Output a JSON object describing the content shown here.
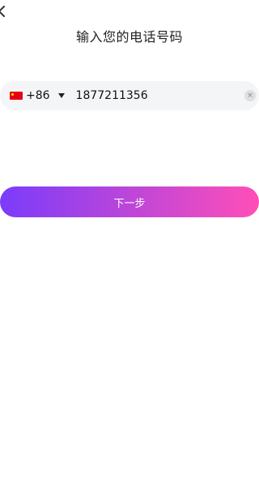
{
  "header": {
    "back_icon": "chevron-left-icon",
    "title": "输入您的电话号码"
  },
  "phone": {
    "flag_icon": "china-flag-icon",
    "country_code": "+86",
    "dropdown_icon": "caret-down-icon",
    "value": "1877211356",
    "clear_icon": "clear-x-icon",
    "clear_glyph": "×"
  },
  "actions": {
    "next_label": "下一步",
    "gradient_start": "#7a3cfb",
    "gradient_end": "#ff4fb7"
  }
}
